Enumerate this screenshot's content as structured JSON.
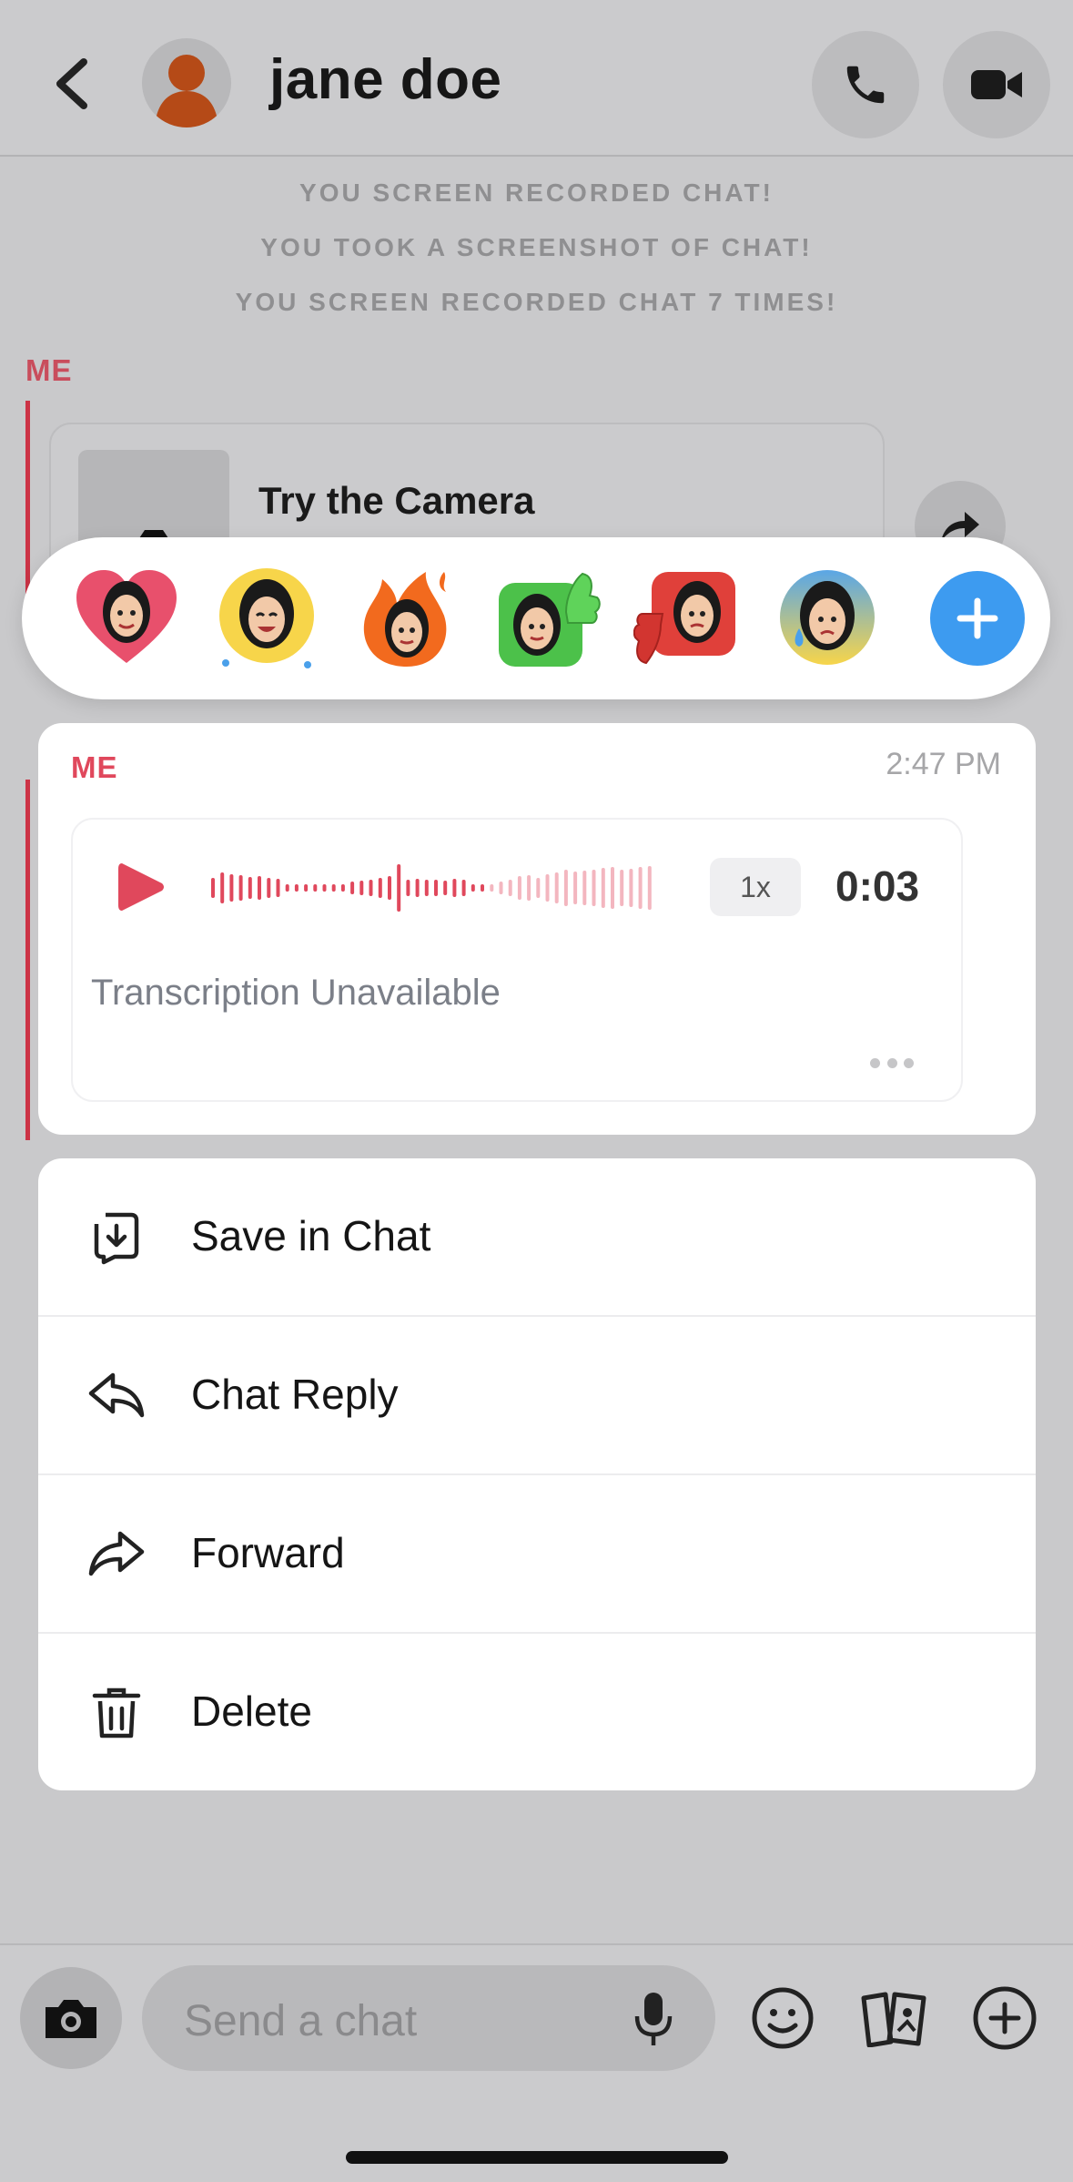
{
  "header": {
    "contact_name": "jane doe",
    "back_icon": "chevron-left-icon",
    "call_icon": "phone-icon",
    "video_icon": "video-camera-icon"
  },
  "system_messages": [
    "YOU SCREEN RECORDED CHAT!",
    "YOU TOOK A SCREENSHOT OF CHAT!",
    "YOU SCREEN RECORDED CHAT 7 TIMES!"
  ],
  "chat": {
    "sender_label": "ME",
    "camera_card_text": "Try the Camera"
  },
  "reactions": {
    "items": [
      {
        "name": "heart-bitmoji",
        "bg": "#e8506c"
      },
      {
        "name": "laughing-bitmoji",
        "bg": "#f7d54a"
      },
      {
        "name": "fire-bitmoji",
        "bg": "#f26a1e"
      },
      {
        "name": "thumbs-up-bitmoji",
        "bg": "#4cc14a"
      },
      {
        "name": "thumbs-down-bitmoji",
        "bg": "#e0403a"
      },
      {
        "name": "crying-bitmoji",
        "bg": "#5aa6e6"
      }
    ],
    "more_icon": "plus-icon"
  },
  "message": {
    "sender": "ME",
    "time": "2:47 PM",
    "speed": "1x",
    "duration": "0:03",
    "transcription": "Transcription Unavailable",
    "played_fraction": 0.63
  },
  "menu": {
    "items": [
      {
        "label": "Save in Chat",
        "icon": "save-in-chat-icon"
      },
      {
        "label": "Chat Reply",
        "icon": "reply-icon"
      },
      {
        "label": "Forward",
        "icon": "forward-icon"
      },
      {
        "label": "Delete",
        "icon": "trash-icon"
      }
    ]
  },
  "composer": {
    "placeholder": "Send a chat"
  },
  "colors": {
    "accent_red": "#e0485c",
    "blue": "#3d9bf0"
  }
}
